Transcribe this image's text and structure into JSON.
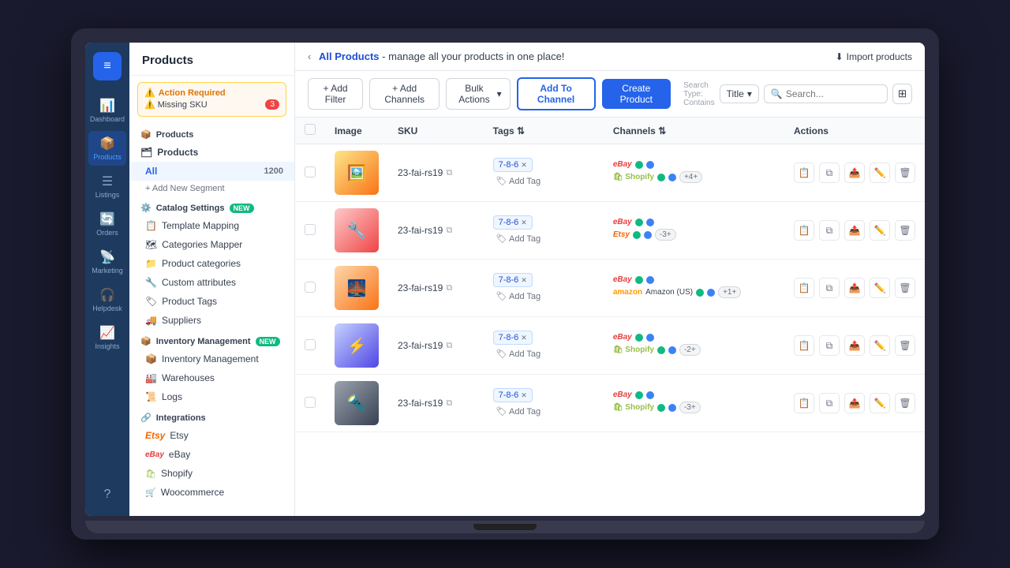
{
  "app": {
    "logo_icon": "≡",
    "title": "Products"
  },
  "nav": {
    "items": [
      {
        "id": "dashboard",
        "label": "Dashboard",
        "icon": "📊"
      },
      {
        "id": "products",
        "label": "Products",
        "icon": "📦",
        "active": true
      },
      {
        "id": "listings",
        "label": "Listings",
        "icon": "☰"
      },
      {
        "id": "orders",
        "label": "Orders",
        "icon": "🔄"
      },
      {
        "id": "marketing",
        "label": "Marketing",
        "icon": "📡"
      },
      {
        "id": "helpdesk",
        "label": "Helpdesk",
        "icon": "🎧"
      },
      {
        "id": "insights",
        "label": "Insights",
        "icon": "📈"
      }
    ],
    "help_icon": "?"
  },
  "sidebar": {
    "header": "Products",
    "alert": {
      "title": "Action Required",
      "items": [
        {
          "label": "Missing SKU",
          "count": 3
        }
      ]
    },
    "segments": {
      "label": "Products",
      "items": [
        {
          "label": "All",
          "count": 1200,
          "active": true
        }
      ],
      "add_label": "+ Add New Segment"
    },
    "catalog_settings": {
      "label": "Catalog Settings",
      "badge": "NEW",
      "items": [
        {
          "label": "Template Mapping"
        },
        {
          "label": "Categories Mapper"
        },
        {
          "label": "Product categories"
        },
        {
          "label": "Custom attributes"
        },
        {
          "label": "Product Tags"
        },
        {
          "label": "Suppliers"
        }
      ]
    },
    "inventory": {
      "label": "Inventory Management",
      "badge": "NEW",
      "items": [
        {
          "label": "Inventory Management"
        },
        {
          "label": "Warehouses"
        },
        {
          "label": "Logs"
        }
      ]
    },
    "integrations": {
      "label": "Integrations",
      "items": [
        {
          "label": "Etsy"
        },
        {
          "label": "eBay"
        },
        {
          "label": "Shopify"
        },
        {
          "label": "Woocommerce"
        }
      ]
    }
  },
  "header": {
    "breadcrumb": "All Products",
    "subtitle": "- manage all your products in one place!",
    "import_label": "Import products"
  },
  "toolbar": {
    "add_filter": "+ Add Filter",
    "add_channels": "+ Add Channels",
    "bulk_actions": "Bulk Actions",
    "add_to_channel": "Add To Channel",
    "create_product": "Create Product",
    "search_type_label": "Search Type: Contains",
    "title_select": "Title",
    "search_placeholder": "Search...",
    "grid_icon": "⊞"
  },
  "table": {
    "columns": [
      "",
      "Image",
      "SKU",
      "Tags",
      "Channels",
      "Actions"
    ],
    "products": [
      {
        "id": 1,
        "image_color": "linear-gradient(135deg, #fde68a, #f59e0b)",
        "image_emoji": "🖼",
        "sku": "23-fai-rs19",
        "tag": "7-8-6",
        "channels": [
          {
            "name": "eBay",
            "type": "ebay",
            "dots": [
              "green",
              "blue"
            ]
          },
          {
            "name": "Shopify",
            "type": "shopify",
            "dots": [
              "green",
              "blue"
            ],
            "more": "+4+"
          }
        ]
      },
      {
        "id": 2,
        "image_color": "linear-gradient(135deg, #fecaca, #ef4444)",
        "image_emoji": "🔧",
        "sku": "23-fai-rs19",
        "tag": "7-8-6",
        "channels": [
          {
            "name": "eBay",
            "type": "ebay",
            "dots": [
              "green",
              "blue"
            ]
          },
          {
            "name": "Etsy",
            "type": "etsy",
            "dots": [
              "green",
              "blue"
            ],
            "more": "-3+"
          }
        ]
      },
      {
        "id": 3,
        "image_color": "linear-gradient(135deg, #fed7aa, #f97316)",
        "image_emoji": "🌉",
        "sku": "23-fai-rs19",
        "tag": "7-8-6",
        "channels": [
          {
            "name": "eBay",
            "type": "ebay",
            "dots": [
              "green",
              "blue"
            ]
          },
          {
            "name": "Amazon (US)",
            "type": "amazon",
            "dots": [
              "green",
              "blue"
            ],
            "more": "+1+"
          }
        ]
      },
      {
        "id": 4,
        "image_color": "linear-gradient(135deg, #c7d2fe, #4f46e5)",
        "image_emoji": "⚡",
        "sku": "23-fai-rs19",
        "tag": "7-8-6",
        "channels": [
          {
            "name": "eBay",
            "type": "ebay",
            "dots": [
              "green",
              "blue"
            ]
          },
          {
            "name": "Shopify",
            "type": "shopify",
            "dots": [
              "green",
              "blue"
            ],
            "more": "-2+"
          }
        ]
      },
      {
        "id": 5,
        "image_color": "linear-gradient(135deg, #6b7280, #374151)",
        "image_emoji": "🔦",
        "sku": "23-fai-rs19",
        "tag": "7-8-6",
        "channels": [
          {
            "name": "eBay",
            "type": "ebay",
            "dots": [
              "green",
              "blue"
            ]
          },
          {
            "name": "Shopify",
            "type": "shopify",
            "dots": [
              "green",
              "blue"
            ],
            "more": "-3+"
          }
        ]
      }
    ]
  }
}
